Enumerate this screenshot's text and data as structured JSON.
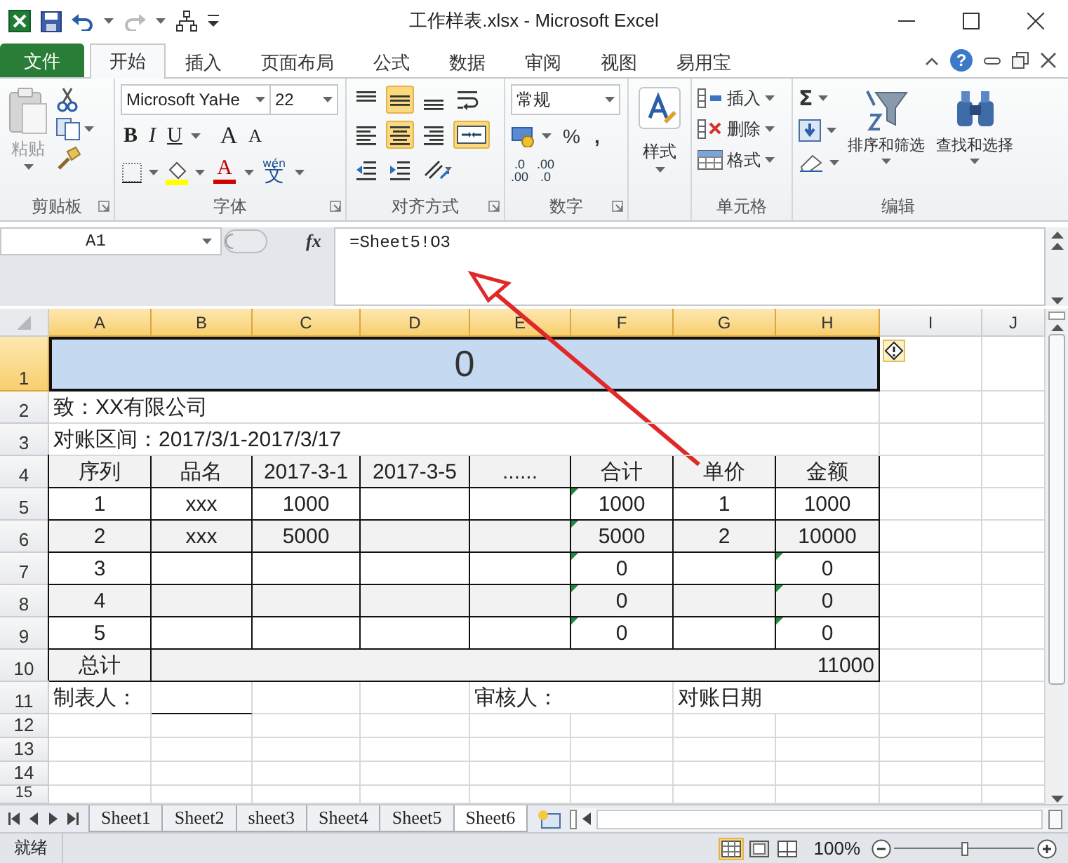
{
  "window": {
    "title": "工作样表.xlsx - Microsoft Excel"
  },
  "tabs": [
    {
      "label": "文件",
      "kind": "file",
      "selected": false
    },
    {
      "label": "开始",
      "kind": "tab",
      "selected": true
    },
    {
      "label": "插入",
      "kind": "tab",
      "selected": false
    },
    {
      "label": "页面布局",
      "kind": "tab",
      "selected": false
    },
    {
      "label": "公式",
      "kind": "tab",
      "selected": false
    },
    {
      "label": "数据",
      "kind": "tab",
      "selected": false
    },
    {
      "label": "审阅",
      "kind": "tab",
      "selected": false
    },
    {
      "label": "视图",
      "kind": "tab",
      "selected": false
    },
    {
      "label": "易用宝",
      "kind": "tab",
      "selected": false
    }
  ],
  "help": "?",
  "ribbon": {
    "clipboard": {
      "label": "剪贴板",
      "paste": "粘贴",
      "paste_disabled": true
    },
    "font": {
      "label": "字体",
      "name": "Microsoft YaHe",
      "size": "22",
      "styles": [
        "B",
        "I",
        "U"
      ],
      "grow": "A",
      "shrink": "A",
      "color_letter": "A",
      "phonetic_top": "wén",
      "phonetic": "文"
    },
    "alignment": {
      "label": "对齐方式",
      "buttons": [
        {
          "kind": "top",
          "selected": false
        },
        {
          "kind": "middle",
          "selected": true
        },
        {
          "kind": "bottom",
          "selected": false
        },
        {
          "kind": "wrap",
          "selected": false
        },
        {
          "kind": "left",
          "selected": false
        },
        {
          "kind": "center",
          "selected": true
        },
        {
          "kind": "right",
          "selected": false
        },
        {
          "kind": "merge",
          "selected": true
        },
        {
          "kind": "outdent",
          "selected": false
        },
        {
          "kind": "indent",
          "selected": false
        },
        {
          "kind": "orientation",
          "selected": false
        }
      ]
    },
    "number": {
      "label": "数字",
      "format": "常规",
      "percent": "%",
      "comma": ",",
      "decimals": [
        {
          "top": ".0",
          "bottom": ".00"
        },
        {
          "top": ".00",
          "bottom": ".0"
        }
      ]
    },
    "styles": {
      "label": "样式"
    },
    "cells": {
      "label": "单元格",
      "items": [
        {
          "kind": "insert",
          "label": "插入"
        },
        {
          "kind": "delete",
          "label": "删除"
        },
        {
          "kind": "format",
          "label": "格式"
        }
      ]
    },
    "editing": {
      "label": "编辑",
      "sum": "Σ",
      "sort": "排序和筛选",
      "find": "查找和选择"
    }
  },
  "formula_bar": {
    "name_box": "A1",
    "fx": "fx",
    "formula": "=Sheet5!O3"
  },
  "sheet": {
    "columns": [
      {
        "label": "A",
        "selected": true
      },
      {
        "label": "B",
        "selected": true
      },
      {
        "label": "C",
        "selected": true
      },
      {
        "label": "D",
        "selected": true
      },
      {
        "label": "E",
        "selected": true
      },
      {
        "label": "F",
        "selected": true
      },
      {
        "label": "G",
        "selected": true
      },
      {
        "label": "H",
        "selected": true
      },
      {
        "label": "I",
        "selected": false
      },
      {
        "label": "J",
        "selected": false
      }
    ],
    "rows": [
      {
        "header": "1",
        "selected": true,
        "kind": "title",
        "text": "0"
      },
      {
        "header": "2",
        "selected": false,
        "kind": "text",
        "cells": [
          {
            "kind": "text",
            "text": "致：XX有限公司"
          },
          {
            "kind": "blank"
          },
          {
            "kind": "blank"
          },
          {
            "kind": "blank"
          },
          {
            "kind": "blank"
          },
          {
            "kind": "blank"
          },
          {
            "kind": "blank"
          },
          {
            "kind": "blank"
          }
        ]
      },
      {
        "header": "3",
        "selected": false,
        "kind": "text",
        "cells": [
          {
            "kind": "text",
            "text": "对账区间：2017/3/1-2017/3/17"
          },
          {
            "kind": "blank"
          },
          {
            "kind": "blank"
          },
          {
            "kind": "blank"
          },
          {
            "kind": "blank"
          },
          {
            "kind": "blank"
          },
          {
            "kind": "blank"
          },
          {
            "kind": "blank"
          }
        ]
      },
      {
        "header": "4",
        "selected": false,
        "kind": "table",
        "shaded": true,
        "cells": [
          {
            "text": "序列",
            "flag": false
          },
          {
            "text": "品名",
            "flag": false
          },
          {
            "text": "2017-3-1",
            "flag": false
          },
          {
            "text": "2017-3-5",
            "flag": false
          },
          {
            "text": "......",
            "flag": false
          },
          {
            "text": "合计",
            "flag": false
          },
          {
            "text": "单价",
            "flag": false
          },
          {
            "text": "金额",
            "flag": false
          }
        ]
      },
      {
        "header": "5",
        "selected": false,
        "kind": "table",
        "shaded": false,
        "cells": [
          {
            "text": "1",
            "flag": false
          },
          {
            "text": "xxx",
            "flag": false
          },
          {
            "text": "1000",
            "flag": false
          },
          {
            "flag": false
          },
          {
            "flag": false
          },
          {
            "text": "1000",
            "flag": true
          },
          {
            "text": "1",
            "flag": false
          },
          {
            "text": "1000",
            "flag": false
          }
        ]
      },
      {
        "header": "6",
        "selected": false,
        "kind": "table",
        "shaded": true,
        "cells": [
          {
            "text": "2",
            "flag": false
          },
          {
            "text": "xxx",
            "flag": false
          },
          {
            "text": "5000",
            "flag": false
          },
          {
            "flag": false
          },
          {
            "flag": false
          },
          {
            "text": "5000",
            "flag": true
          },
          {
            "text": "2",
            "flag": false
          },
          {
            "text": "10000",
            "flag": false
          }
        ]
      },
      {
        "header": "7",
        "selected": false,
        "kind": "table",
        "shaded": false,
        "cells": [
          {
            "text": "3",
            "flag": false
          },
          {
            "flag": false
          },
          {
            "flag": false
          },
          {
            "flag": false
          },
          {
            "flag": false
          },
          {
            "text": "0",
            "flag": true
          },
          {
            "flag": false
          },
          {
            "text": "0",
            "flag": true
          }
        ]
      },
      {
        "header": "8",
        "selected": false,
        "kind": "table",
        "shaded": true,
        "cells": [
          {
            "text": "4",
            "flag": false
          },
          {
            "flag": false
          },
          {
            "flag": false
          },
          {
            "flag": false
          },
          {
            "flag": false
          },
          {
            "text": "0",
            "flag": true
          },
          {
            "flag": false
          },
          {
            "text": "0",
            "flag": true
          }
        ]
      },
      {
        "header": "9",
        "selected": false,
        "kind": "table",
        "shaded": false,
        "cells": [
          {
            "text": "5",
            "flag": false
          },
          {
            "flag": false
          },
          {
            "flag": false
          },
          {
            "flag": false
          },
          {
            "flag": false
          },
          {
            "text": "0",
            "flag": true
          },
          {
            "flag": false
          },
          {
            "text": "0",
            "flag": true
          }
        ]
      },
      {
        "header": "10",
        "selected": false,
        "kind": "total",
        "shaded": true,
        "label": "总计",
        "total": "11000"
      },
      {
        "header": "11",
        "selected": false,
        "kind": "text",
        "cells": [
          {
            "kind": "text",
            "text": "制表人："
          },
          {
            "kind": "line"
          },
          {
            "kind": "blank"
          },
          {
            "kind": "blank"
          },
          {
            "kind": "text",
            "text": "审核人："
          },
          {
            "kind": "blank"
          },
          {
            "kind": "text",
            "text": "对账日期"
          },
          {
            "kind": "blank"
          }
        ]
      },
      {
        "header": "12",
        "selected": false,
        "kind": "empty"
      },
      {
        "header": "13",
        "selected": false,
        "kind": "empty"
      },
      {
        "header": "14",
        "selected": false,
        "kind": "empty"
      },
      {
        "header": "15",
        "selected": false,
        "kind": "empty"
      }
    ]
  },
  "sheet_tabs": [
    {
      "label": "Sheet1",
      "selected": false
    },
    {
      "label": "Sheet2",
      "selected": false
    },
    {
      "label": "sheet3",
      "selected": false
    },
    {
      "label": "Sheet4",
      "selected": false
    },
    {
      "label": "Sheet5",
      "selected": false
    },
    {
      "label": "Sheet6",
      "selected": true
    }
  ],
  "status_bar": {
    "status": "就绪",
    "views": [
      {
        "kind": "normal",
        "selected": true
      },
      {
        "kind": "layout",
        "selected": false
      },
      {
        "kind": "break",
        "selected": false
      }
    ],
    "zoom": "100%",
    "zoom_slider": {
      "level": 0.5
    }
  }
}
